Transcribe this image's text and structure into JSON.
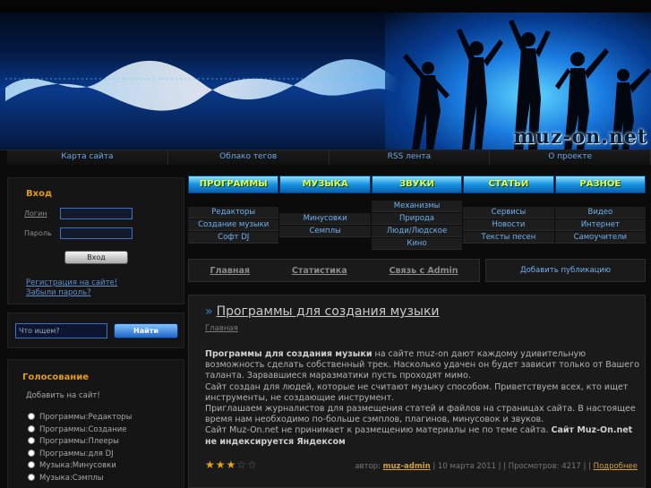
{
  "banner": {
    "logo": "muz-on.net"
  },
  "top_links": [
    "Карта сайта",
    "Облако тегов",
    "RSS лента",
    "О проекте"
  ],
  "login": {
    "title": "Вход",
    "login_label": "Логин",
    "password_label": "Пароль",
    "submit": "Вход",
    "register": "Регистрация на сайте!",
    "forgot": "Забыли пароль?"
  },
  "search": {
    "placeholder": "Что ищем?",
    "button": "Найти"
  },
  "vote": {
    "title": "Голосование",
    "question": "Добавить на сайт!",
    "options": [
      "Программы:Редакторы",
      "Программы:Создание",
      "Программы:Плееры",
      "Программы:для DJ",
      "Музыка:Минусовки",
      "Музыка:Сэмплы"
    ]
  },
  "nav": {
    "tabs": [
      "ПРОГРАММЫ",
      "МУЗЫКА",
      "ЗВУКИ",
      "СТАТЬИ",
      "РАЗНОЕ"
    ],
    "sub": [
      [
        "Редакторы",
        "Создание музыки",
        "Софт DJ"
      ],
      [
        "Минусовки",
        "Семплы"
      ],
      [
        "Механизмы",
        "Природа",
        "Люди/Людское",
        "Кино"
      ],
      [
        "Сервисы",
        "Новости",
        "Тексты песен"
      ],
      [
        "Видео",
        "Интернет",
        "Самоучители"
      ]
    ]
  },
  "secondary": {
    "links": [
      "Главная",
      "Статистика",
      "Связь с Admin"
    ],
    "add": "Добавить публикацию"
  },
  "article": {
    "title": "Программы для создания музыки",
    "crumb": "Главная",
    "intro_bold": "Программы для создания музыки",
    "intro_rest": " на сайте muz-on дают каждому удивительную возможность сделать собственный трек. Насколько удачен он будет зависит только от Вашего таланта. Зарвавшиеся мараз­матики пусть проходят мимо.",
    "p2": "Сайт создан для людей, которые не считают музыку способом. Приветствуем всех, кто ищет инструменты, не создающие инструмент.",
    "p3": "Приглашаем журналистов для размещения статей и файлов на страницах сайта. В настоящее время нам необходимо по-больше сэмплов, плагинов, минусовок и звуков.",
    "p4_start": "Сайт Muz-On.net не принимает к размещению материалы не по теме сайта. ",
    "p4_bold": "Сайт Muz-On.net не индексируется Яндексом",
    "rating": 3,
    "rating_max": 5,
    "author_label": "автор:",
    "author": "muz-admin",
    "date": "| 10 марта 2011 |",
    "views": "| Просмотров: 4217 | |",
    "more": "Подробнее"
  },
  "colors": {
    "accent": "#e09a1c",
    "link": "#6eb1f0",
    "nav_blue": "#1793e0"
  }
}
